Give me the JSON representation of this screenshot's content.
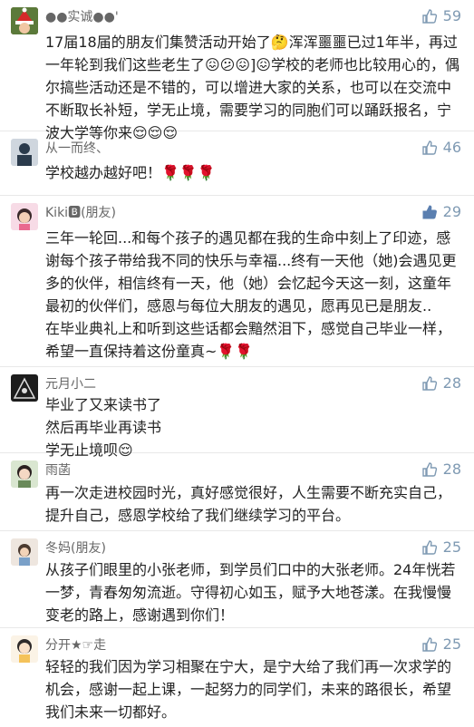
{
  "colors": {
    "like_color": "#7f9ab3",
    "like_active": "#5a7fb0",
    "text": "#222222",
    "name": "#666666"
  },
  "comments": [
    {
      "name": "●●实诚●●'",
      "likes": "59",
      "avatar_icon": "santa-avatar",
      "text": "17届18届的朋友们集赞活动开始了🤔浑浑噩噩已过1年半，再过一年轮到我们这些老生了😖😕😖]😖学校的老师也比较用心的，偶尔搞些活动还是不错的，可以增进大家的关系，也可以在交流中不断取长补短，学无止境，需要学习的同胞们可以踊跃报名，宁波大学等你来😌😌😌"
    },
    {
      "name": "从一而终、",
      "likes": "46",
      "avatar_icon": "person-avatar",
      "text": "学校越办越好吧！🌹🌹🌹"
    },
    {
      "name": "Kiki🅱(朋友)",
      "likes": "29",
      "avatar_icon": "girl-avatar",
      "text": "三年一轮回...和每个孩子的遇见都在我的生命中刻上了印迹，感谢每个孩子带给我不同的快乐与幸福...终有一天他（她)会遇见更多的伙伴，相信终有一天，他（她）会忆起今天这一刻，这童年最初的伙伴们，感恩与每位大朋友的遇见，愿再见已是朋友..",
      "text2": "在毕业典礼上和听到这些话都会黯然泪下，感觉自己毕业一样，希望一直保持着这份童真~🌹🌹"
    },
    {
      "name": "元月小二",
      "likes": "28",
      "avatar_icon": "dark-avatar",
      "lines": [
        "毕业了又来读书了",
        "然后再毕业再读书",
        "学无止境呗😌"
      ]
    },
    {
      "name": "雨菡",
      "likes": "28",
      "avatar_icon": "girl2-avatar",
      "text": "再一次走进校园时光，真好感觉很好，人生需要不断充实自己，提升自己，感恩学校给了我们继续学习的平台。"
    },
    {
      "name": "冬妈(朋友)",
      "likes": "25",
      "avatar_icon": "child-avatar",
      "text": "从孩子们眼里的小张老师，到学员们口中的大张老师。24年恍若一梦，青春匆匆流逝。守得初心如玉，赋予大地苍漾。在我慢慢变老的路上，感谢遇到你们！"
    },
    {
      "name": "分开★☞走",
      "likes": "25",
      "avatar_icon": "cartoon-avatar",
      "text": "轻轻的我们因为学习相聚在宁大，是宁大给了我们再一次求学的机会，感谢一起上课，一起努力的同学们，未来的路很长，希望我们未来一切都好。"
    }
  ]
}
